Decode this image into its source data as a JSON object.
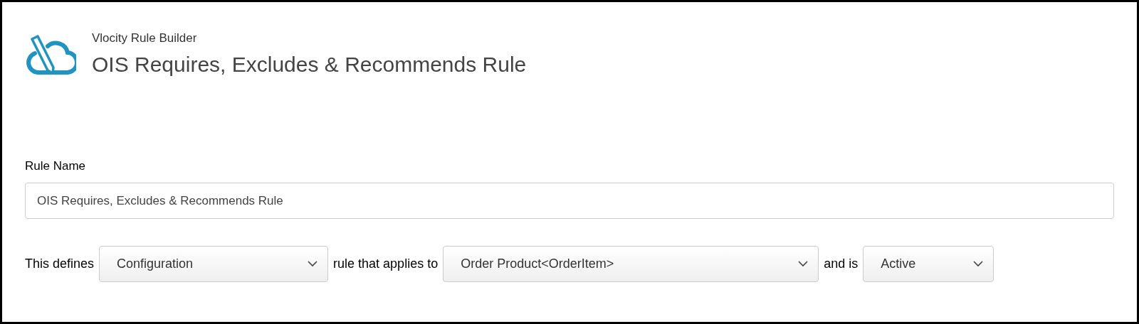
{
  "header": {
    "app_name": "Vlocity Rule Builder",
    "title": "OIS Requires, Excludes & Recommends Rule"
  },
  "rule_name": {
    "label": "Rule Name",
    "value": "OIS Requires, Excludes & Recommends Rule"
  },
  "definition": [
    {
      "kind": "text",
      "text": "This defines"
    },
    {
      "kind": "select",
      "value": "Configuration"
    },
    {
      "kind": "text",
      "text": "rule that applies to"
    },
    {
      "kind": "select",
      "value": "Order Product<OrderItem>"
    },
    {
      "kind": "text",
      "text": "and is"
    },
    {
      "kind": "select",
      "value": "Active"
    }
  ]
}
